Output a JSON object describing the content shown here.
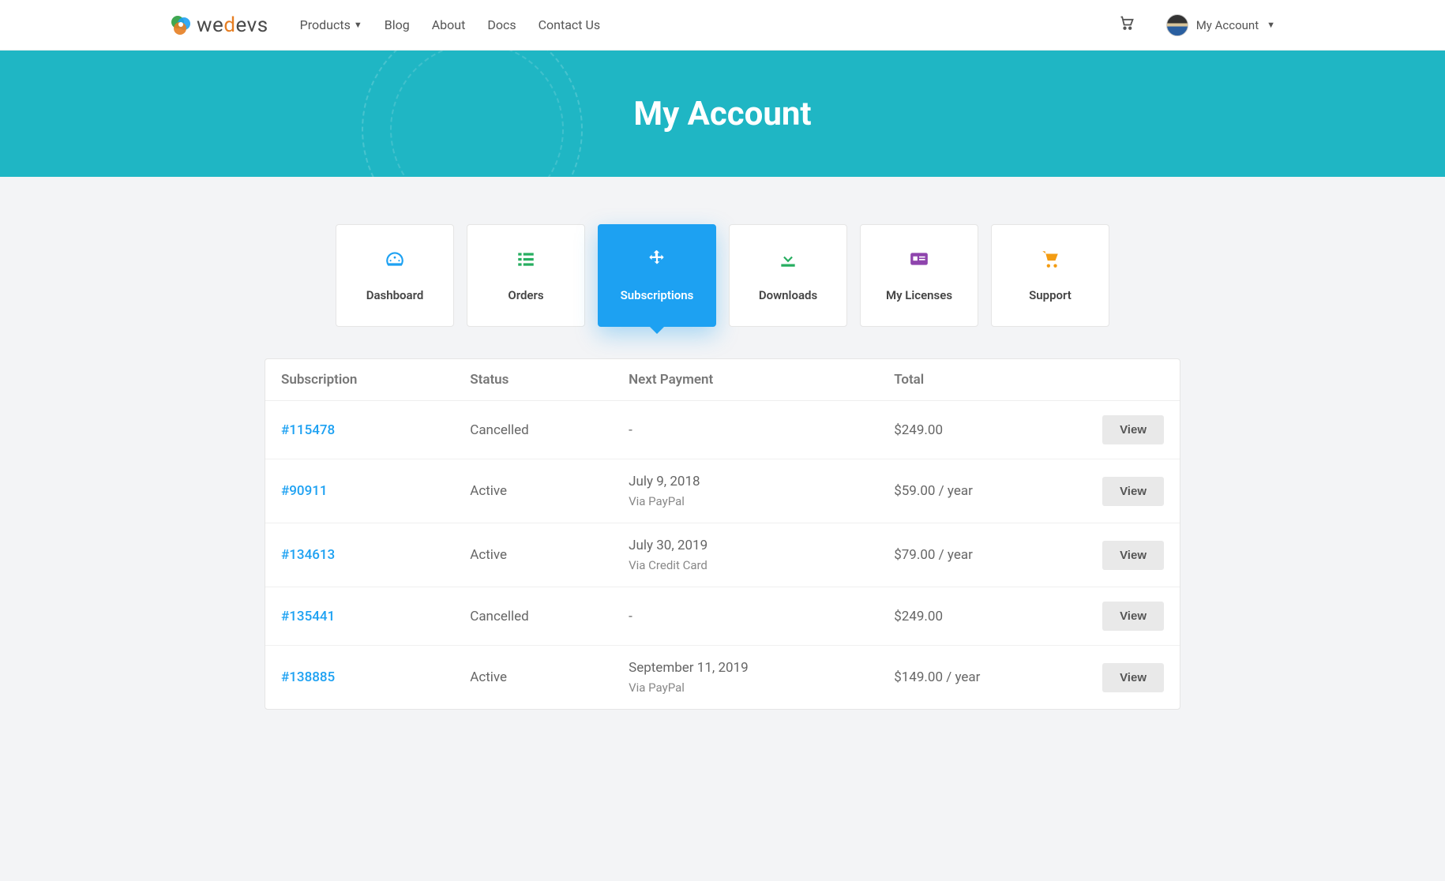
{
  "nav": {
    "logo_text_pre": "we",
    "logo_text_d": "d",
    "logo_text_post": "evs",
    "items": [
      {
        "label": "Products",
        "dropdown": true
      },
      {
        "label": "Blog",
        "dropdown": false
      },
      {
        "label": "About",
        "dropdown": false
      },
      {
        "label": "Docs",
        "dropdown": false
      },
      {
        "label": "Contact Us",
        "dropdown": false
      }
    ],
    "account_label": "My Account"
  },
  "banner": {
    "title": "My Account"
  },
  "tabs": [
    {
      "label": "Dashboard",
      "icon": "gauge",
      "color": "#1da1f2"
    },
    {
      "label": "Orders",
      "icon": "list",
      "color": "#27ae60"
    },
    {
      "label": "Subscriptions",
      "icon": "move",
      "color": "#ffffff",
      "active": true
    },
    {
      "label": "Downloads",
      "icon": "download",
      "color": "#27ae60"
    },
    {
      "label": "My Licenses",
      "icon": "id-card",
      "color": "#8e44ad"
    },
    {
      "label": "Support",
      "icon": "cart",
      "color": "#f39c12"
    }
  ],
  "table": {
    "headers": [
      "Subscription",
      "Status",
      "Next Payment",
      "Total",
      ""
    ],
    "view_label": "View",
    "rows": [
      {
        "id": "#115478",
        "status": "Cancelled",
        "next_payment": "-",
        "next_payment_sub": "",
        "total": "$249.00"
      },
      {
        "id": "#90911",
        "status": "Active",
        "next_payment": "July 9, 2018",
        "next_payment_sub": "Via PayPal",
        "total": "$59.00 / year"
      },
      {
        "id": "#134613",
        "status": "Active",
        "next_payment": "July 30, 2019",
        "next_payment_sub": "Via Credit Card",
        "total": "$79.00 / year"
      },
      {
        "id": "#135441",
        "status": "Cancelled",
        "next_payment": "-",
        "next_payment_sub": "",
        "total": "$249.00"
      },
      {
        "id": "#138885",
        "status": "Active",
        "next_payment": "September 11, 2019",
        "next_payment_sub": "Via PayPal",
        "total": "$149.00 / year"
      }
    ]
  }
}
